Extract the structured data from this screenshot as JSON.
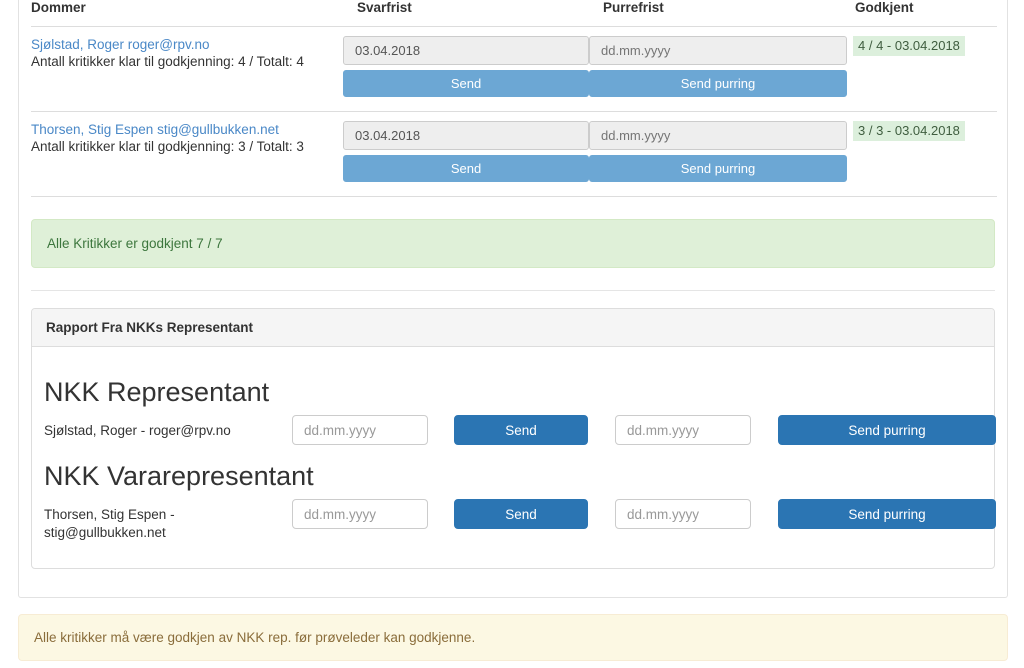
{
  "table": {
    "columns": [
      "Dommer",
      "Svarfrist",
      "Purrefrist",
      "Godkjent"
    ],
    "rows": [
      {
        "judge_name": "Sjølstad, Roger roger@rpv.no",
        "judge_count": "Antall kritikker klar til godkjenning: 4 / Totalt: 4",
        "svarfrist_value": "03.04.2018",
        "svarfrist_placeholder": "dd.mm.yyyy",
        "svarfrist_button": "Send",
        "purrefrist_value": "",
        "purrefrist_placeholder": "dd.mm.yyyy",
        "purrefrist_button": "Send purring",
        "godkjent": "4 / 4 - 03.04.2018"
      },
      {
        "judge_name": "Thorsen, Stig Espen stig@gullbukken.net",
        "judge_count": "Antall kritikker klar til godkjenning: 3 / Totalt: 3",
        "svarfrist_value": "03.04.2018",
        "svarfrist_placeholder": "dd.mm.yyyy",
        "svarfrist_button": "Send",
        "purrefrist_value": "",
        "purrefrist_placeholder": "dd.mm.yyyy",
        "purrefrist_button": "Send purring",
        "godkjent": "3 / 3 - 03.04.2018"
      }
    ]
  },
  "success_alert": {
    "text": "Alle Kritikker er godkjent 7 / 7"
  },
  "report_panel": {
    "heading": "Rapport Fra NKKs Representant",
    "representatives": [
      {
        "title": "NKK Representant",
        "person": "Sjølstad, Roger - roger@rpv.no",
        "svarfrist_value": "",
        "svarfrist_placeholder": "dd.mm.yyyy",
        "send_label": "Send",
        "purrefrist_value": "",
        "purrefrist_placeholder": "dd.mm.yyyy",
        "purring_label": "Send purring"
      },
      {
        "title": "NKK Vararepresentant",
        "person": "Thorsen, Stig Espen - stig@gullbukken.net",
        "svarfrist_value": "",
        "svarfrist_placeholder": "dd.mm.yyyy",
        "send_label": "Send",
        "purrefrist_value": "",
        "purrefrist_placeholder": "dd.mm.yyyy",
        "purring_label": "Send purring"
      }
    ]
  },
  "warning_alert": {
    "text": "Alle kritikker må være godkjen av NKK rep. før prøveleder kan godkjenne."
  },
  "colors": {
    "link": "#4a88c7",
    "primary_button": "#2b75b3",
    "disabled_button": "#6ca7d4",
    "success_bg": "#dff0d8",
    "success_text": "#3c763d",
    "badge_bg": "#dcefdc",
    "warning_bg": "#fcf8e3",
    "warning_text": "#8a6d3b"
  }
}
